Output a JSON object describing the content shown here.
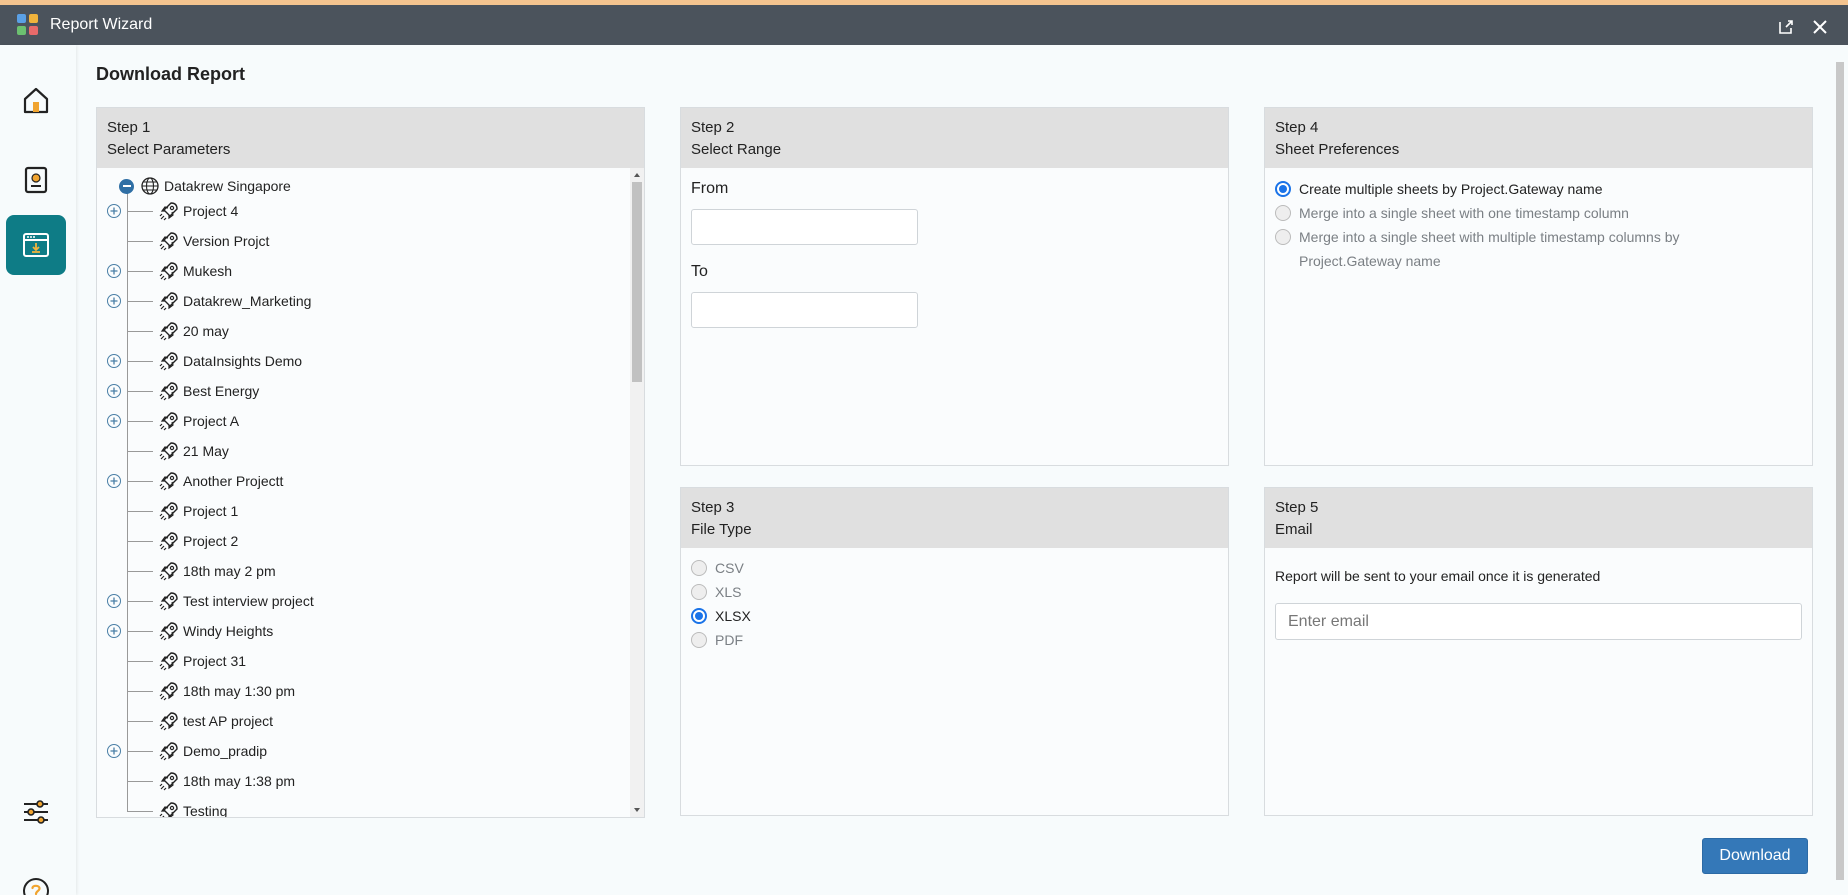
{
  "window": {
    "title": "Report Wizard"
  },
  "page": {
    "title": "Download Report"
  },
  "sidebar": {
    "items": [
      {
        "name": "home-icon",
        "active": false
      },
      {
        "name": "report-icon",
        "active": false
      },
      {
        "name": "download-window-icon",
        "active": true
      },
      {
        "name": "sliders-icon",
        "active": false
      },
      {
        "name": "help-icon",
        "active": false
      }
    ]
  },
  "step1": {
    "title": "Step 1",
    "subtitle": "Select Parameters",
    "root": "Datakrew Singapore",
    "items": [
      {
        "label": "Project 4",
        "expandable": true
      },
      {
        "label": "Version Projct",
        "expandable": false
      },
      {
        "label": "Mukesh",
        "expandable": true
      },
      {
        "label": "Datakrew_Marketing",
        "expandable": true
      },
      {
        "label": "20 may",
        "expandable": false
      },
      {
        "label": "DataInsights Demo",
        "expandable": true
      },
      {
        "label": "Best Energy",
        "expandable": true
      },
      {
        "label": "Project A",
        "expandable": true
      },
      {
        "label": "21 May",
        "expandable": false
      },
      {
        "label": "Another Projectt",
        "expandable": true
      },
      {
        "label": "Project 1",
        "expandable": false
      },
      {
        "label": "Project 2",
        "expandable": false
      },
      {
        "label": "18th may 2 pm",
        "expandable": false
      },
      {
        "label": "Test interview project",
        "expandable": true
      },
      {
        "label": "Windy Heights",
        "expandable": true
      },
      {
        "label": "Project 31",
        "expandable": false
      },
      {
        "label": "18th may 1:30 pm",
        "expandable": false
      },
      {
        "label": "test AP project",
        "expandable": false
      },
      {
        "label": "Demo_pradip",
        "expandable": true
      },
      {
        "label": "18th may 1:38 pm",
        "expandable": false
      },
      {
        "label": "Testing",
        "expandable": false
      }
    ]
  },
  "step2": {
    "title": "Step 2",
    "subtitle": "Select Range",
    "from_label": "From",
    "from_value": "",
    "to_label": "To",
    "to_value": ""
  },
  "step3": {
    "title": "Step 3",
    "subtitle": "File Type",
    "options": [
      {
        "label": "CSV",
        "checked": false
      },
      {
        "label": "XLS",
        "checked": false
      },
      {
        "label": "XLSX",
        "checked": true
      },
      {
        "label": "PDF",
        "checked": false
      }
    ]
  },
  "step4": {
    "title": "Step 4",
    "subtitle": "Sheet Preferences",
    "options": [
      {
        "label": "Create multiple sheets by Project.Gateway name",
        "checked": true
      },
      {
        "label": "Merge into a single sheet with one timestamp column",
        "checked": false
      },
      {
        "label": "Merge into a single sheet with multiple timestamp columns by Project.Gateway name",
        "checked": false
      }
    ]
  },
  "step5": {
    "title": "Step 5",
    "subtitle": "Email",
    "info": "Report will be sent to your email once it is generated",
    "email_placeholder": "Enter email",
    "email_value": ""
  },
  "actions": {
    "download_label": "Download"
  },
  "colors": {
    "titlebar": "#4b535c",
    "active_nav": "#0e7c86",
    "accent": "#1a73e8",
    "button": "#3478b8"
  }
}
